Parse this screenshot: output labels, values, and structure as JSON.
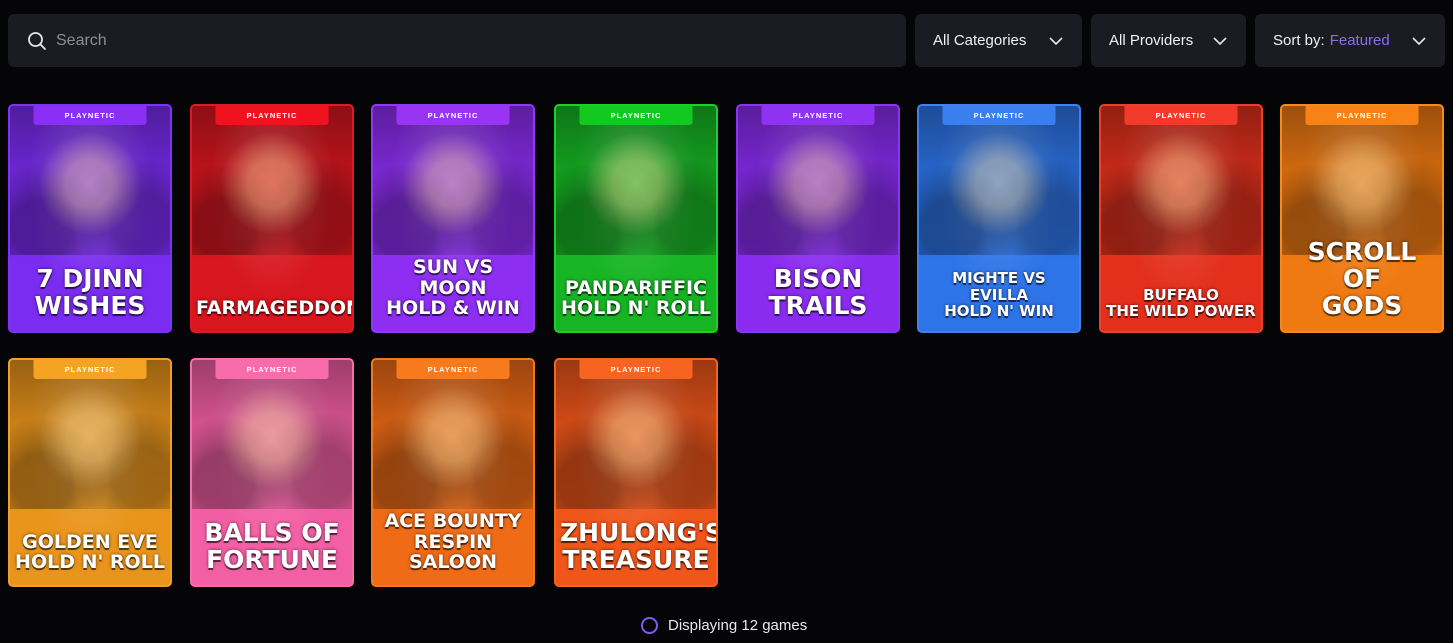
{
  "search": {
    "placeholder": "Search",
    "icon": "search-icon"
  },
  "filters": {
    "categories_label": "All Categories",
    "providers_label": "All Providers",
    "sort_prefix": "Sort by:",
    "sort_value": "Featured"
  },
  "colors": {
    "accent": "#8b6df0",
    "panel": "#1b1c22",
    "background": "#050507"
  },
  "games": [
    {
      "provider": "PLAYNETIC",
      "title": "7 DJINN\nWISHES",
      "theme": "#7a2cf0",
      "badge": "#8a2ff5",
      "border": "#7b35f2"
    },
    {
      "provider": "PLAYNETIC",
      "title": "FARMAGEDDON",
      "theme": "#d8161f",
      "badge": "#f0121e",
      "border": "#e01a22"
    },
    {
      "provider": "PLAYNETIC",
      "title": "SUN VS MOON\nHOLD & WIN",
      "theme": "#8d2ef2",
      "badge": "#9a34f5",
      "border": "#9238f0"
    },
    {
      "provider": "PLAYNETIC",
      "title": "PANDARIFFIC\nHOLD N' ROLL",
      "theme": "#17b524",
      "badge": "#12c91f",
      "border": "#1ccf2a"
    },
    {
      "provider": "PLAYNETIC",
      "title": "BISON\nTRAILS",
      "theme": "#8a2cf0",
      "badge": "#8f33f3",
      "border": "#8a36ef"
    },
    {
      "provider": "PLAYNETIC",
      "title": "MIGHTE VS EVILLA\nHOLD N' WIN",
      "theme": "#2d74e8",
      "badge": "#3a7ff0",
      "border": "#3f82ee"
    },
    {
      "provider": "PLAYNETIC",
      "title": "BUFFALO\nTHE WILD POWER",
      "theme": "#e3301c",
      "badge": "#f23a2a",
      "border": "#e8422c"
    },
    {
      "provider": "PLAYNETIC",
      "title": "SCROLL OF\nGODS",
      "theme": "#f07a12",
      "badge": "#f78316",
      "border": "#f38a22"
    },
    {
      "provider": "PLAYNETIC",
      "title": "GOLDEN EVE\nHOLD N' ROLL",
      "theme": "#e9951c",
      "badge": "#f5a322",
      "border": "#f0a02a"
    },
    {
      "provider": "PLAYNETIC",
      "title": "BALLS OF\nFORTUNE",
      "theme": "#f35fa4",
      "badge": "#f86cac",
      "border": "#f56ea9"
    },
    {
      "provider": "PLAYNETIC",
      "title": "ACE BOUNTY\nRESPIN SALOON",
      "theme": "#ef6b16",
      "badge": "#f77b1c",
      "border": "#f0781f"
    },
    {
      "provider": "PLAYNETIC",
      "title": "ZHULONG'S\nTREASURE",
      "theme": "#f0561a",
      "badge": "#f76320",
      "border": "#f0661f"
    }
  ],
  "footer": {
    "status": "Displaying 12 games"
  }
}
